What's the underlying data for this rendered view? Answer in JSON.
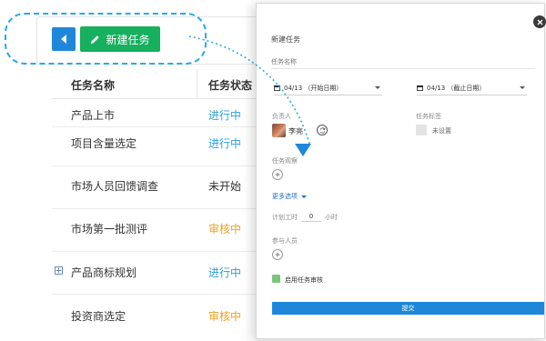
{
  "toolbar": {
    "back_icon": "caret-left-icon",
    "new_task_label": "新建任务",
    "new_task_icon": "pencil-icon",
    "back_color": "#1e87d9",
    "new_color": "#16b05e"
  },
  "task_table": {
    "headers": {
      "name": "任务名称",
      "status": "任务状态"
    },
    "rows": [
      {
        "name": "产品上市",
        "status": "进行中",
        "status_color": "#2b9fe0"
      },
      {
        "name": "项目含量选定",
        "status": "进行中",
        "status_color": "#2b9fe0"
      },
      {
        "name": "市场人员回馈调查",
        "status": "未开始",
        "status_color": "#333333"
      },
      {
        "name": "市场第一批测评",
        "status": "审核中",
        "status_color": "#f0a020"
      },
      {
        "name": "产品商标规划",
        "status": "进行中",
        "status_color": "#2b9fe0"
      },
      {
        "name": "投资商选定",
        "status": "审核中",
        "status_color": "#f0a020"
      }
    ],
    "expand_icon": "plus-square-icon"
  },
  "dialog": {
    "title": "新建任务",
    "name_placeholder": "任务名称",
    "start_date": "04/13 （开始日期）",
    "end_date": "04/13 （截止日期）",
    "owner_label": "负责人",
    "owner_name": "李亮",
    "tag_label": "任务标签",
    "tag_value": "未设置",
    "watchers_label": "任务观察",
    "more_options": "更多选项",
    "planned_hours_label": "计划工时",
    "planned_hours_value": "0",
    "hours_unit": "小时",
    "participants_label": "参与人员",
    "review_label": "启用任务审核",
    "submit_label": "提交",
    "calendar_icon": "calendar-icon",
    "close_icon": "close-icon",
    "accent_color": "#1e87d9"
  }
}
